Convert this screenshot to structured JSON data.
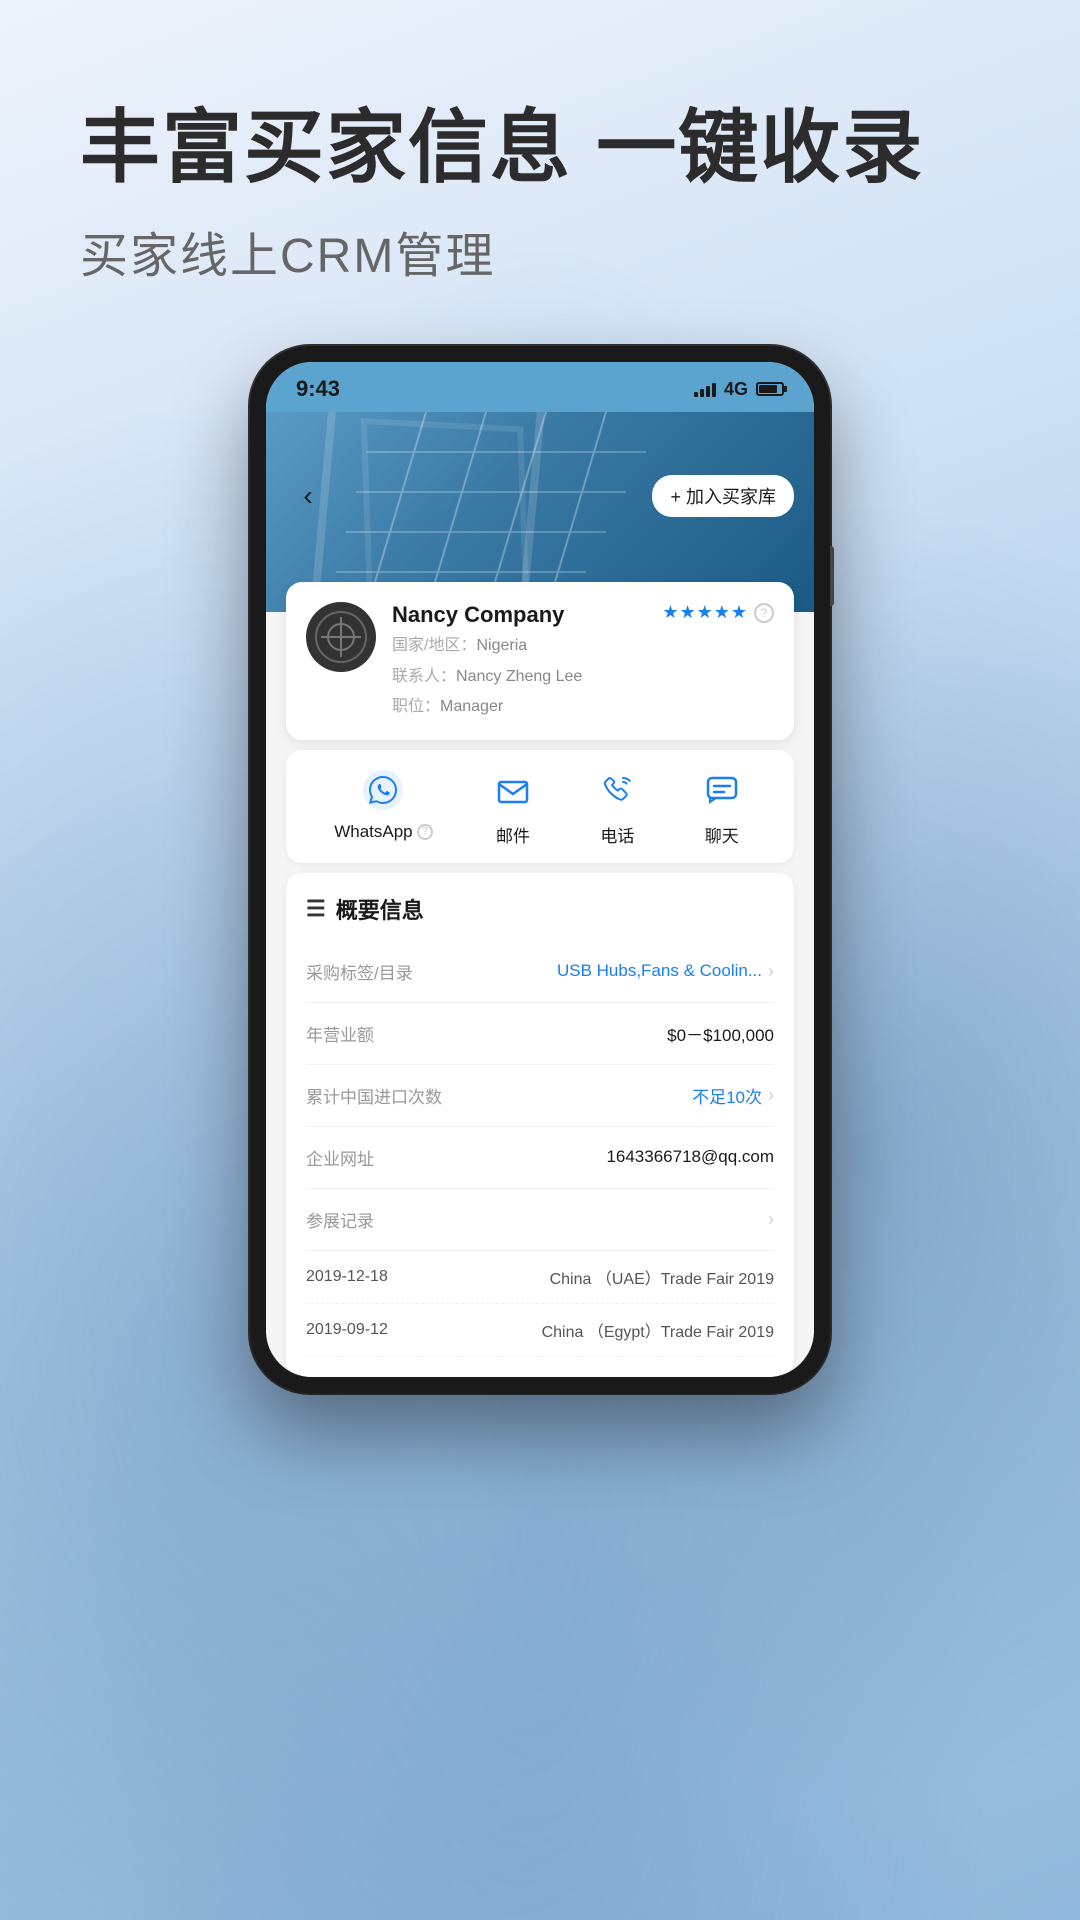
{
  "page": {
    "main_title": "丰富买家信息 一键收录",
    "sub_title": "买家线上CRM管理"
  },
  "phone": {
    "status_bar": {
      "time": "9:43",
      "signal": "4G"
    },
    "nav": {
      "add_button": "+ 加入买家库"
    },
    "company": {
      "name": "Nancy Company",
      "country_label": "国家/地区：",
      "country": "Nigeria",
      "contact_label": "联系人：",
      "contact": "Nancy Zheng Lee",
      "position_label": "职位：",
      "position": "Manager",
      "stars": "★★★★★"
    },
    "actions": [
      {
        "label": "WhatsApp",
        "icon": "whatsapp"
      },
      {
        "label": "邮件",
        "icon": "mail"
      },
      {
        "label": "电话",
        "icon": "phone"
      },
      {
        "label": "聊天",
        "icon": "chat"
      }
    ],
    "info_section": {
      "title": "概要信息",
      "rows": [
        {
          "label": "采购标签/目录",
          "value": "USB Hubs,Fans & Coolin...",
          "has_chevron": true
        },
        {
          "label": "年营业额",
          "value": "$0－$100,000",
          "has_chevron": false
        },
        {
          "label": "累计中国进口次数",
          "value": "不足10次",
          "has_chevron": true
        },
        {
          "label": "企业网址",
          "value": "1643366718@qq.com",
          "has_chevron": false
        },
        {
          "label": "参展记录",
          "value": "",
          "has_chevron": true
        }
      ],
      "trade_records": [
        {
          "date": "2019-12-18",
          "event": "China （UAE）Trade Fair 2019"
        },
        {
          "date": "2019-09-12",
          "event": "China （Egypt）Trade Fair 2019"
        }
      ]
    }
  }
}
